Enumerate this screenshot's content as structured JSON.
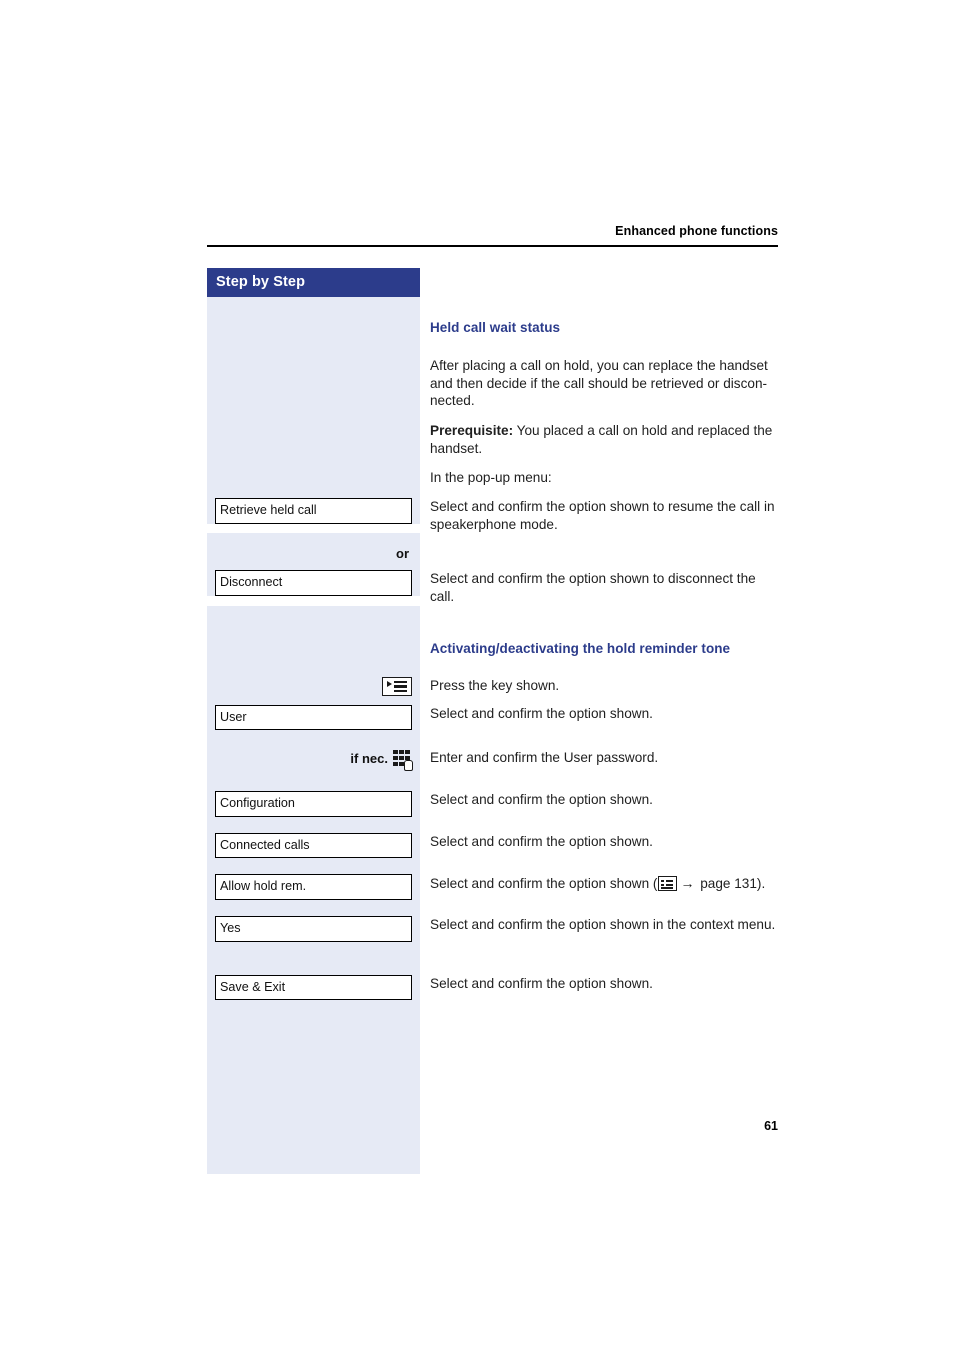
{
  "header": {
    "running_title": "Enhanced phone functions"
  },
  "sidebar": {
    "title": "Step by Step",
    "accent_color": "#2c3c8b",
    "background_color": "#e6eaf5"
  },
  "page": {
    "number": "61"
  },
  "sections": [
    {
      "heading": "Held call wait status",
      "heading_color": "#2c3c8b",
      "paragraphs": [
        "After placing a call on hold, you can replace the handset and then decide if the call should be retrieved or discon-nected.",
        "Prerequisite: You placed a call on hold and replaced the handset.",
        "In the pop-up menu:"
      ],
      "prerequisite_label": "Prerequisite:",
      "prerequisite_body": " You placed a call on hold and replaced the handset.",
      "intro_body": "After placing a call on hold, you can replace the handset and then decide if the call should be retrieved or discon-nected.",
      "popup_line": "In the pop-up menu:"
    },
    {
      "heading": "Activating/deactivating the hold reminder tone",
      "heading_color": "#2c3c8b"
    }
  ],
  "steps": [
    {
      "left_kind": "optbox",
      "left_label": "Retrieve held call",
      "right_text": "Select and confirm the option shown to resume the call in speakerphone mode."
    },
    {
      "left_kind": "or",
      "left_label": "or",
      "right_text": ""
    },
    {
      "left_kind": "optbox",
      "left_label": "Disconnect",
      "right_text": "Select and confirm the option shown to disconnect the call."
    },
    {
      "left_kind": "icon",
      "left_icon": "key-icon",
      "left_label": "",
      "right_text": "Press the key shown."
    },
    {
      "left_kind": "optbox",
      "left_label": "User",
      "right_text": "Select and confirm the option shown."
    },
    {
      "left_kind": "icon-with-label",
      "left_label": "if nec.",
      "left_icon": "keypad-icon",
      "right_text": "Enter and confirm the User password."
    },
    {
      "left_kind": "optbox",
      "left_label": "Configuration",
      "right_text": "Select and confirm the option shown."
    },
    {
      "left_kind": "optbox",
      "left_label": "Connected calls",
      "right_text": "Select and confirm the option shown."
    },
    {
      "left_kind": "optbox",
      "left_label": "Allow hold rem.",
      "right_text_prefix": "Select and confirm the option shown (",
      "right_icon": "list-icon",
      "right_arrow": "→",
      "right_text_suffix": " page 131)."
    },
    {
      "left_kind": "optbox",
      "left_label": "Yes",
      "right_text": "Select and confirm the option shown in the context menu."
    },
    {
      "left_kind": "optbox",
      "left_label": "Save & Exit",
      "right_text": "Select and confirm the option shown."
    }
  ],
  "cross_reference": {
    "page_ref": " page 131).",
    "prefix": "Select and confirm the option shown (",
    "arrow": "→"
  }
}
